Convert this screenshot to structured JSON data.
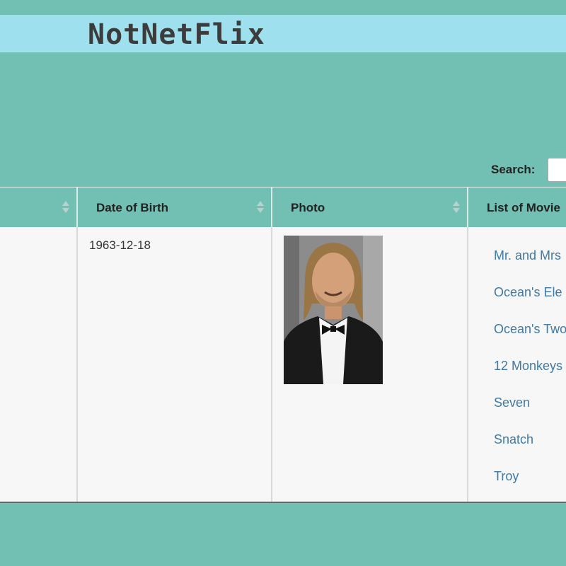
{
  "header": {
    "brand": "NotNetFlix"
  },
  "search": {
    "label": "Search:",
    "value": ""
  },
  "table": {
    "columns": [
      {
        "label": ""
      },
      {
        "label": "Date of Birth"
      },
      {
        "label": "Photo"
      },
      {
        "label": "List of Movie"
      }
    ],
    "row": {
      "date_of_birth": "1963-12-18",
      "movies": [
        "Mr. and Mrs",
        "Ocean's Ele",
        "Ocean's Two",
        "12 Monkeys",
        "Seven",
        "Snatch",
        "Troy"
      ]
    }
  },
  "colors": {
    "background": "#72c0b3",
    "banner": "#9fe0ef",
    "link": "#3f79a8",
    "row": "#f7f7f7"
  }
}
